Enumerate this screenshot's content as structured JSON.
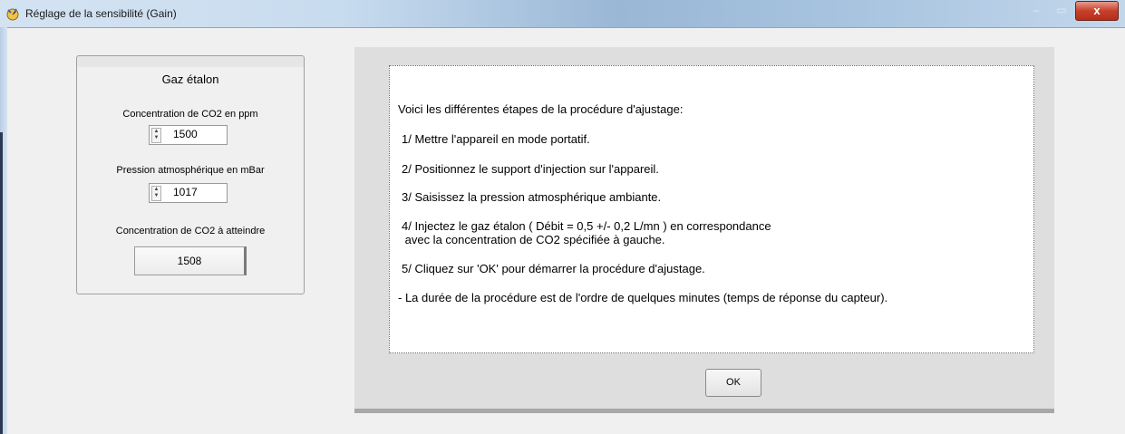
{
  "window": {
    "title": "Réglage de la sensibilité (Gain)",
    "close_label": "x",
    "minimize_label": "–",
    "maximize_label": "▭"
  },
  "gas_panel": {
    "title": "Gaz étalon",
    "co2_label": "Concentration de CO2 en ppm",
    "co2_value": "1500",
    "pressure_label": "Pression atmosphérique en mBar",
    "pressure_value": "1017",
    "target_label": "Concentration de CO2 à atteindre",
    "target_value": "1508"
  },
  "instructions": {
    "intro": "Voici les différentes étapes de la procédure d'ajustage:",
    "steps": [
      "1/ Mettre l'appareil en mode portatif.",
      "2/ Positionnez le support d'injection sur l'appareil.",
      "3/ Saisissez la pression atmosphérique ambiante.",
      "4/ Injectez le gaz étalon ( Débit = 0,5 +/- 0,2 L/mn ) en correspondance",
      " avec la concentration de CO2 spécifiée à gauche.",
      "5/ Cliquez sur 'OK' pour démarrer la procédure d'ajustage.",
      "- La durée de la procédure est de l'ordre de quelques minutes (temps de réponse du capteur)."
    ]
  },
  "buttons": {
    "ok_label": "OK"
  },
  "colors": {
    "close_button": "#c7402b",
    "panel_background": "#dedede"
  },
  "icons": {
    "app": "gauge-icon",
    "spin": "spin-arrows-icon"
  }
}
